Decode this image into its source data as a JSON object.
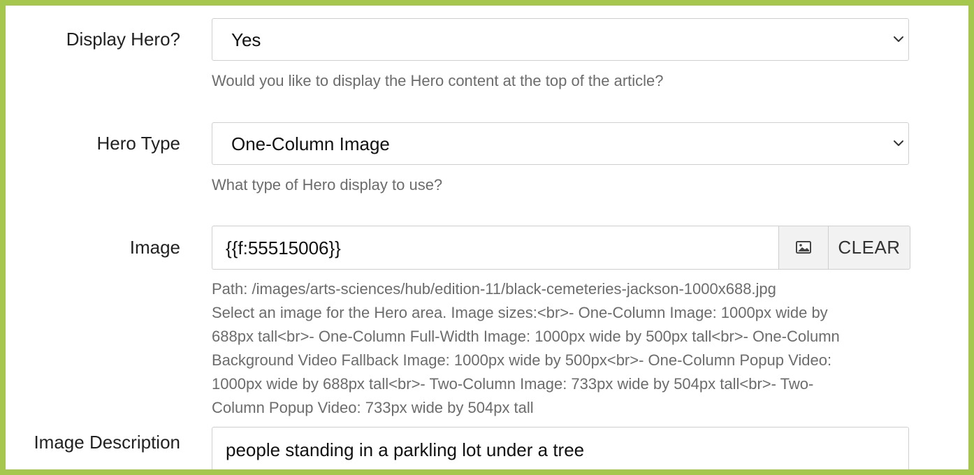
{
  "fields": {
    "display_hero": {
      "label": "Display Hero?",
      "value": "Yes",
      "help": "Would you like to display the Hero content at the top of the article?"
    },
    "hero_type": {
      "label": "Hero Type",
      "value": "One-Column Image",
      "help": "What type of Hero display to use?"
    },
    "image": {
      "label": "Image",
      "value": "{{f:55515006}}",
      "clear_label": "CLEAR",
      "select_icon": "image-icon",
      "help_lines": [
        "Path: /images/arts-sciences/hub/edition-11/black-cemeteries-jackson-1000x688.jpg",
        "Select an image for the Hero area. Image sizes:<br>- One-Column Image: 1000px wide by",
        "688px tall<br>- One-Column Full-Width Image: 1000px wide by 500px tall<br>- One-Column",
        "Background Video Fallback Image: 1000px wide by 500px<br>- One-Column Popup Video:",
        "1000px wide by 688px tall<br>- Two-Column Image: 733px wide by 504px tall<br>- Two-",
        "Column Popup Video: 733px wide by 504px tall"
      ]
    },
    "image_description": {
      "label": "Image Description",
      "value": "people standing in a parkling lot under a tree"
    }
  },
  "colors": {
    "frame_border": "#a6c74e",
    "input_border": "#cfcfcf",
    "help_text": "#6c6c6c"
  }
}
